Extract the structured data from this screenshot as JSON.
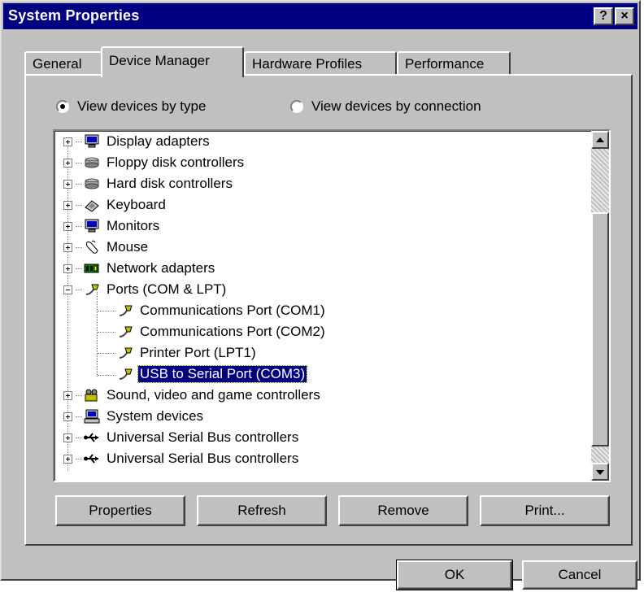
{
  "window": {
    "title": "System Properties",
    "help_glyph": "?",
    "close_glyph": "×"
  },
  "tabs": [
    {
      "label": "General",
      "active": false
    },
    {
      "label": "Device Manager",
      "active": true
    },
    {
      "label": "Hardware Profiles",
      "active": false
    },
    {
      "label": "Performance",
      "active": false
    }
  ],
  "view_options": {
    "by_type": "View devices by type",
    "by_connection": "View devices by connection",
    "selected": "by_type"
  },
  "tree": {
    "items": [
      {
        "label": "Display adapters",
        "icon": "display-adapter-icon",
        "expanded": false
      },
      {
        "label": "Floppy disk controllers",
        "icon": "disk-controller-icon",
        "expanded": false
      },
      {
        "label": "Hard disk controllers",
        "icon": "disk-controller-icon",
        "expanded": false
      },
      {
        "label": "Keyboard",
        "icon": "keyboard-icon",
        "expanded": false
      },
      {
        "label": "Monitors",
        "icon": "monitor-icon",
        "expanded": false
      },
      {
        "label": "Mouse",
        "icon": "mouse-icon",
        "expanded": false
      },
      {
        "label": "Network adapters",
        "icon": "network-adapter-icon",
        "expanded": false
      },
      {
        "label": "Ports (COM & LPT)",
        "icon": "port-icon",
        "expanded": true
      },
      {
        "label": "Communications Port (COM1)",
        "icon": "port-icon",
        "child": true
      },
      {
        "label": "Communications Port (COM2)",
        "icon": "port-icon",
        "child": true
      },
      {
        "label": "Printer Port (LPT1)",
        "icon": "port-icon",
        "child": true
      },
      {
        "label": "USB to Serial Port (COM3)",
        "icon": "port-icon",
        "child": true,
        "selected": true
      },
      {
        "label": "Sound, video and game controllers",
        "icon": "sound-icon",
        "expanded": false
      },
      {
        "label": "System devices",
        "icon": "system-devices-icon",
        "expanded": false
      },
      {
        "label": "Universal Serial Bus controllers",
        "icon": "usb-icon",
        "expanded": false
      },
      {
        "label": "Universal Serial Bus controllers",
        "icon": "usb-icon",
        "expanded": false
      }
    ]
  },
  "buttons": {
    "properties": "Properties",
    "refresh": "Refresh",
    "remove": "Remove",
    "print": "Print...",
    "ok": "OK",
    "cancel": "Cancel"
  },
  "colors": {
    "title_bar": "#000080",
    "face": "#c0c0c0",
    "selection": "#000080"
  }
}
